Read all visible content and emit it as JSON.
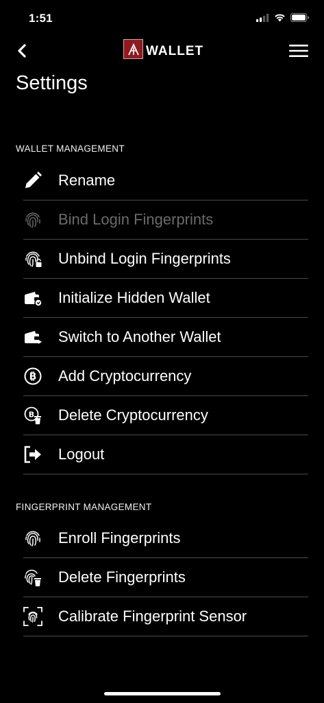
{
  "status_bar": {
    "time": "1:51"
  },
  "nav": {
    "logo_text": "WALLET"
  },
  "page": {
    "title": "Settings"
  },
  "wallet_management": {
    "header": "WALLET MANAGEMENT",
    "items": [
      {
        "label": "Rename",
        "icon": "pencil-icon",
        "enabled": true
      },
      {
        "label": "Bind Login Fingerprints",
        "icon": "fingerprint-icon",
        "enabled": false
      },
      {
        "label": "Unbind Login Fingerprints",
        "icon": "fingerprint-unbind-icon",
        "enabled": true
      },
      {
        "label": "Initialize Hidden Wallet",
        "icon": "wallet-hidden-icon",
        "enabled": true
      },
      {
        "label": "Switch to Another Wallet",
        "icon": "wallet-switch-icon",
        "enabled": true
      },
      {
        "label": "Add Cryptocurrency",
        "icon": "bitcoin-icon",
        "enabled": true
      },
      {
        "label": "Delete Cryptocurrency",
        "icon": "bitcoin-delete-icon",
        "enabled": true
      },
      {
        "label": "Logout",
        "icon": "logout-icon",
        "enabled": true
      }
    ]
  },
  "fingerprint_management": {
    "header": "FINGERPRINT MANAGEMENT",
    "items": [
      {
        "label": "Enroll Fingerprints",
        "icon": "fingerprint-icon",
        "enabled": true
      },
      {
        "label": "Delete Fingerprints",
        "icon": "fingerprint-delete-icon",
        "enabled": true
      },
      {
        "label": "Calibrate Fingerprint Sensor",
        "icon": "fingerprint-scan-icon",
        "enabled": true
      }
    ]
  },
  "colors": {
    "background": "#000000",
    "text": "#ffffff",
    "disabled_text": "#6a6a6a",
    "divider": "#4a4a4a",
    "brand_red": "#8e1b1f"
  }
}
